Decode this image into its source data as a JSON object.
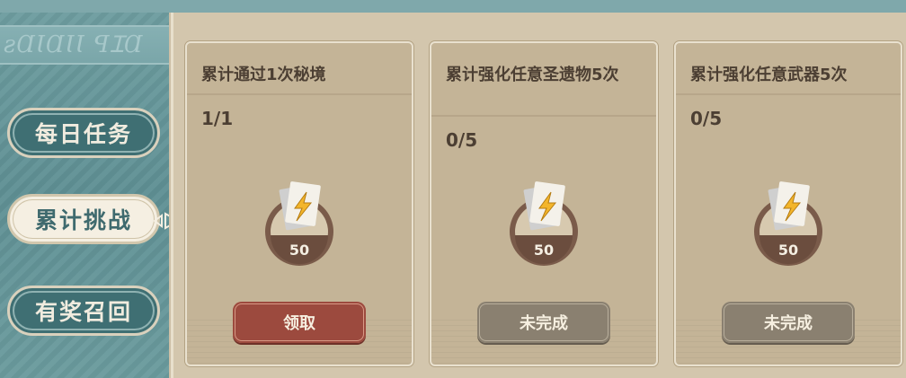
{
  "sidebar": {
    "ribbon_text": "ꙅⱭꙆⱭꙆꙆ ꟼꞮⱭ",
    "tabs": [
      {
        "label": "每日任务"
      },
      {
        "label": "累计挑战"
      },
      {
        "label": "有奖召回"
      }
    ],
    "active_tab": "累计挑战"
  },
  "cards": [
    {
      "title": "累计通过1次秘境",
      "progress": "1/1",
      "reward_amount": "50",
      "reward_icon": "lightning-ticket-icon",
      "button": "领取",
      "button_state": "claim"
    },
    {
      "title": "累计强化任意圣遗物5次",
      "progress": "0/5",
      "reward_amount": "50",
      "reward_icon": "lightning-ticket-icon",
      "button": "未完成",
      "button_state": "incomplete"
    },
    {
      "title": "累计强化任意武器5次",
      "progress": "0/5",
      "reward_amount": "50",
      "reward_icon": "lightning-ticket-icon",
      "button": "未完成",
      "button_state": "incomplete"
    }
  ],
  "colors": {
    "teal_panel": "#5f9094",
    "paper": "#d3c6ad",
    "card": "#c4b497",
    "claim_button": "#9c4a3e",
    "incomplete_button": "#8a8070"
  }
}
